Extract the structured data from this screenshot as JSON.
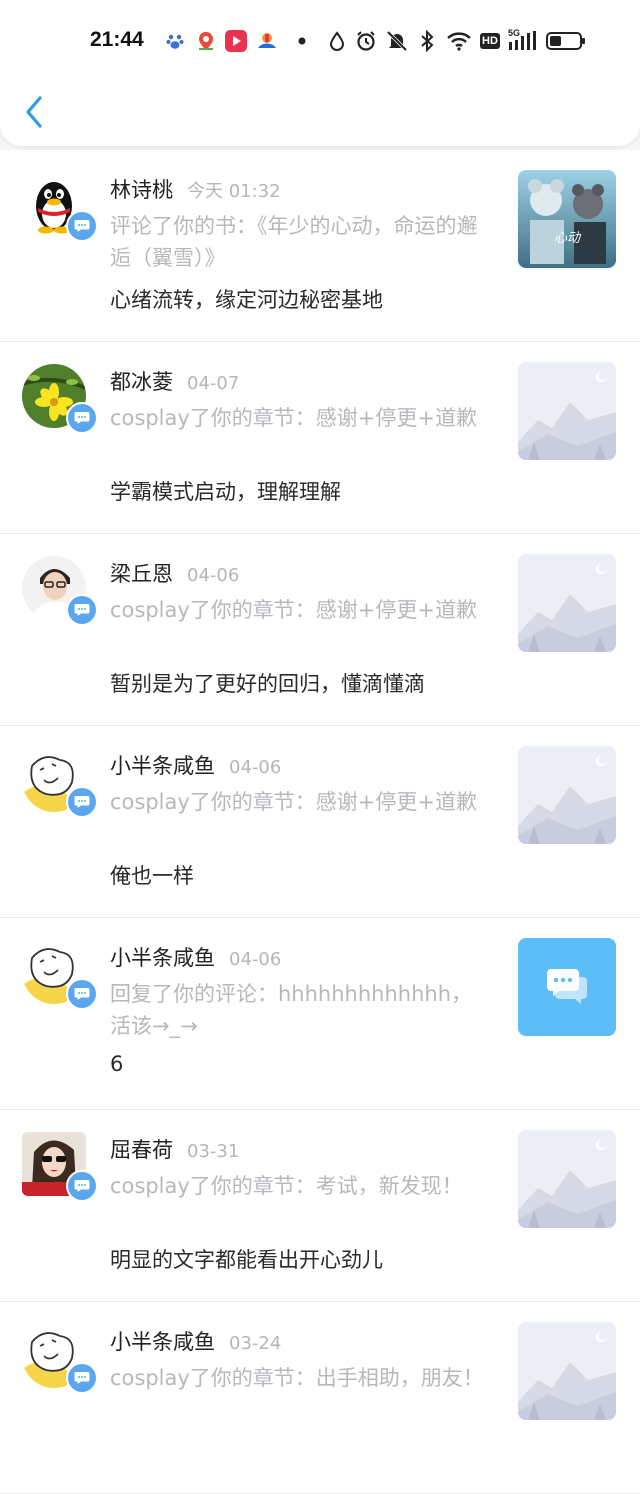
{
  "status_bar": {
    "time": "21:44",
    "network": "5G",
    "hd": "HD"
  },
  "header": {
    "back_icon": "chevron-left-icon"
  },
  "notifications": [
    {
      "name": "林诗桃",
      "time": "今天 01:32",
      "action": "评论了你的书：《年少的心动，命运的邂逅（翼雪）》",
      "comment": "心绪流转，缘定河边秘密基地",
      "avatar": "qq-penguin",
      "thumb": "book-cover"
    },
    {
      "name": "都冰菱",
      "time": "04-07",
      "action": "cosplay了你的章节：感谢+停更+道歉",
      "comment": "学霸模式启动，理解理解",
      "avatar": "yellow-flower",
      "thumb": "placeholder-landscape"
    },
    {
      "name": "梁丘恩",
      "time": "04-06",
      "action": "cosplay了你的章节：感谢+停更+道歉",
      "comment": "暂别是为了更好的回归，懂滴懂滴",
      "avatar": "person-glasses",
      "thumb": "placeholder-landscape"
    },
    {
      "name": "小半条咸鱼",
      "time": "04-06",
      "action": "cosplay了你的章节：感谢+停更+道歉",
      "comment": "俺也一样",
      "avatar": "doodle-cat",
      "thumb": "placeholder-landscape"
    },
    {
      "name": "小半条咸鱼",
      "time": "04-06",
      "action": "回复了你的评论：hhhhhhhhhhhhh，活该→_→",
      "comment": "6",
      "avatar": "doodle-cat",
      "thumb": "reply-chat-icon"
    },
    {
      "name": "屈春荷",
      "time": "03-31",
      "action": "cosplay了你的章节：考试，新发现！",
      "comment": "明显的文字都能看出开心劲儿",
      "avatar": "woman-sunglasses",
      "thumb": "placeholder-landscape"
    },
    {
      "name": "小半条咸鱼",
      "time": "03-24",
      "action": "cosplay了你的章节：出手相助，朋友！",
      "comment": "",
      "avatar": "doodle-cat",
      "thumb": "placeholder-landscape"
    }
  ],
  "colors": {
    "accent": "#2f9be8",
    "badge": "#5aa7ee",
    "reply_thumb": "#5dbdf7"
  }
}
